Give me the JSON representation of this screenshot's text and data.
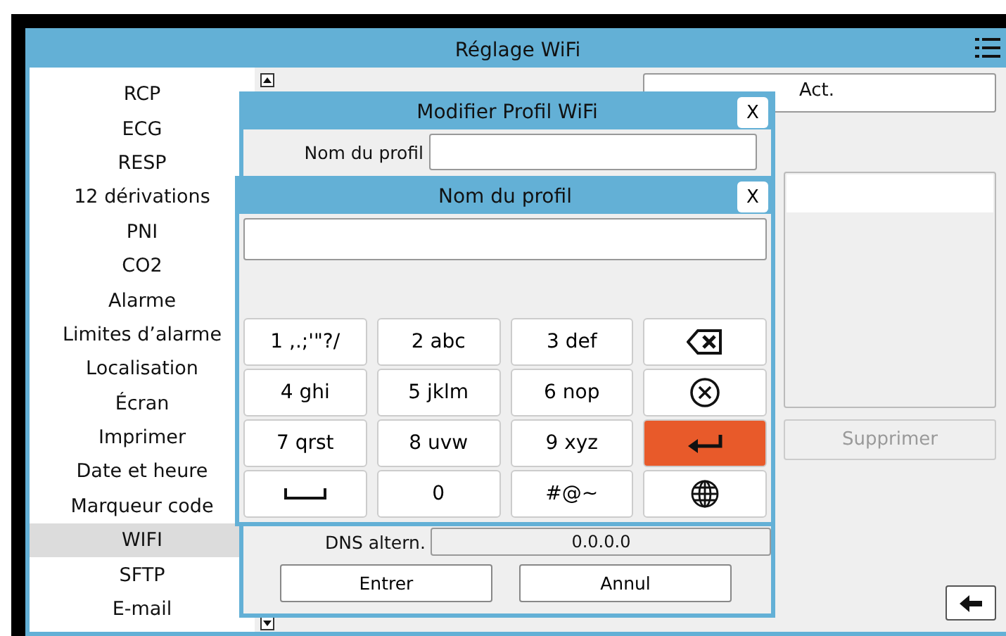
{
  "window": {
    "title": "Réglage WiFi"
  },
  "sidebar": {
    "items": [
      {
        "label": "RCP",
        "selected": false
      },
      {
        "label": "ECG",
        "selected": false
      },
      {
        "label": "RESP",
        "selected": false
      },
      {
        "label": "12 dérivations",
        "selected": false
      },
      {
        "label": "PNI",
        "selected": false
      },
      {
        "label": "CO2",
        "selected": false
      },
      {
        "label": "Alarme",
        "selected": false
      },
      {
        "label": "Limites d’alarme",
        "selected": false
      },
      {
        "label": "Localisation",
        "selected": false
      },
      {
        "label": "Écran",
        "selected": false
      },
      {
        "label": "Imprimer",
        "selected": false
      },
      {
        "label": "Date et heure",
        "selected": false
      },
      {
        "label": "Marqueur code",
        "selected": false
      },
      {
        "label": "WIFI",
        "selected": true
      },
      {
        "label": "SFTP",
        "selected": false
      },
      {
        "label": "E-mail",
        "selected": false
      }
    ]
  },
  "settings": {
    "field_value": "Act.",
    "delete_button": {
      "label": "Supprimer",
      "disabled": true
    }
  },
  "profile_dialog": {
    "title": "Modifier Profil WiFi",
    "close": "X",
    "name_label": "Nom du profil",
    "dns_label": "DNS altern.",
    "dns_value": "0.0.0.0",
    "buttons": [
      "Entrer",
      "Annul"
    ]
  },
  "keyboard": {
    "title": "Nom du profil",
    "close": "X",
    "keys": [
      {
        "kind": "text",
        "label": "1 ,.;'\"?/"
      },
      {
        "kind": "text",
        "label": "2 abc"
      },
      {
        "kind": "text",
        "label": "3 def"
      },
      {
        "kind": "backspace"
      },
      {
        "kind": "text",
        "label": "4 ghi"
      },
      {
        "kind": "text",
        "label": "5 jklm"
      },
      {
        "kind": "text",
        "label": "6 nop"
      },
      {
        "kind": "clear"
      },
      {
        "kind": "text",
        "label": "7 qrst"
      },
      {
        "kind": "text",
        "label": "8 uvw"
      },
      {
        "kind": "text",
        "label": "9 xyz"
      },
      {
        "kind": "enter"
      },
      {
        "kind": "space"
      },
      {
        "kind": "text",
        "label": "0"
      },
      {
        "kind": "text",
        "label": "#@~"
      },
      {
        "kind": "globe"
      }
    ]
  }
}
